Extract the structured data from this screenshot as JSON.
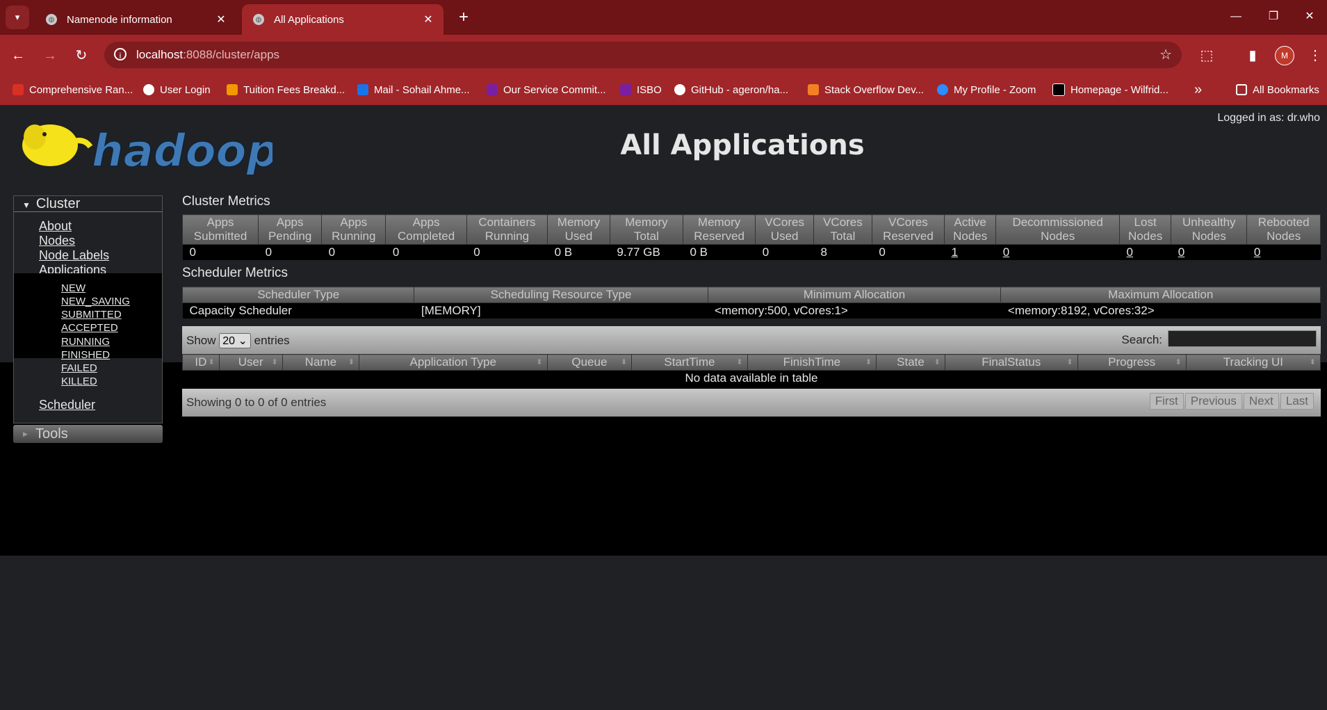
{
  "browser": {
    "tabs": [
      {
        "title": "Namenode information",
        "close": "✕"
      },
      {
        "title": "All Applications",
        "close": "✕"
      }
    ],
    "new_tab": "+",
    "url_host": "localhost",
    "url_path": ":8088/cluster/apps",
    "profile_initial": "M",
    "bookmarks": [
      "Comprehensive Ran...",
      "User Login",
      "Tuition Fees Breakd...",
      "Mail - Sohail Ahme...",
      "Our Service Commit...",
      "ISBO",
      "GitHub - ageron/ha...",
      "Stack Overflow Dev...",
      "My Profile - Zoom",
      "Homepage - Wilfrid..."
    ],
    "more_bookmarks": "»",
    "all_bookmarks": "All Bookmarks"
  },
  "page": {
    "title": "All Applications",
    "logged_in": "Logged in as: dr.who",
    "logo_text": "hadoop"
  },
  "sidebar": {
    "cluster": "Cluster",
    "links": [
      "About",
      "Nodes",
      "Node Labels",
      "Applications"
    ],
    "app_states": [
      "NEW",
      "NEW_SAVING",
      "SUBMITTED",
      "ACCEPTED",
      "RUNNING",
      "FINISHED",
      "FAILED",
      "KILLED"
    ],
    "scheduler": "Scheduler",
    "tools": "Tools"
  },
  "cluster_metrics": {
    "title": "Cluster Metrics",
    "headers": [
      [
        "Apps",
        "Submitted"
      ],
      [
        "Apps",
        "Pending"
      ],
      [
        "Apps",
        "Running"
      ],
      [
        "Apps",
        "Completed"
      ],
      [
        "Containers",
        "Running"
      ],
      [
        "Memory",
        "Used"
      ],
      [
        "Memory",
        "Total"
      ],
      [
        "Memory",
        "Reserved"
      ],
      [
        "VCores",
        "Used"
      ],
      [
        "VCores",
        "Total"
      ],
      [
        "VCores",
        "Reserved"
      ],
      [
        "Active",
        "Nodes"
      ],
      [
        "Decommissioned",
        "Nodes"
      ],
      [
        "Lost",
        "Nodes"
      ],
      [
        "Unhealthy",
        "Nodes"
      ],
      [
        "Rebooted",
        "Nodes"
      ]
    ],
    "values": [
      "0",
      "0",
      "0",
      "0",
      "0",
      "0 B",
      "9.77 GB",
      "0 B",
      "0",
      "8",
      "0",
      "1",
      "0",
      "0",
      "0",
      "0"
    ]
  },
  "scheduler_metrics": {
    "title": "Scheduler Metrics",
    "headers": [
      "Scheduler Type",
      "Scheduling Resource Type",
      "Minimum Allocation",
      "Maximum Allocation"
    ],
    "values": [
      "Capacity Scheduler",
      "[MEMORY]",
      "<memory:500, vCores:1>",
      "<memory:8192, vCores:32>"
    ]
  },
  "apps_table": {
    "show_label": "Show",
    "page_size": "20",
    "entries_label": "entries",
    "search_label": "Search:",
    "columns": [
      "ID",
      "User",
      "Name",
      "Application Type",
      "Queue",
      "StartTime",
      "FinishTime",
      "State",
      "FinalStatus",
      "Progress",
      "Tracking UI"
    ],
    "empty": "No data available in table",
    "info": "Showing 0 to 0 of 0 entries",
    "pager": [
      "First",
      "Previous",
      "Next",
      "Last"
    ]
  }
}
